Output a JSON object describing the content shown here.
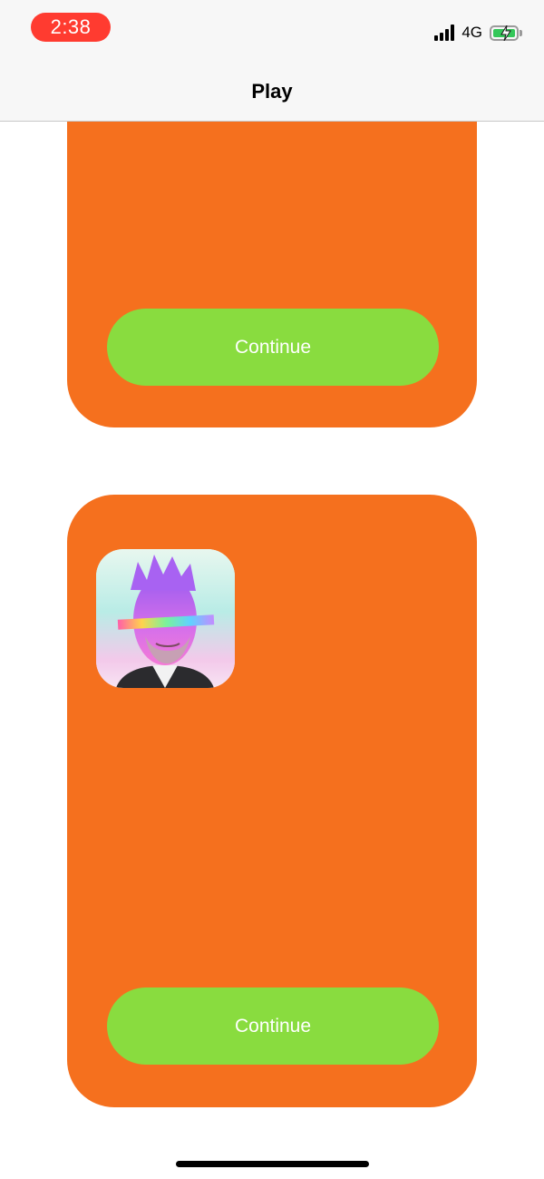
{
  "status_bar": {
    "time": "2:38",
    "network": "4G",
    "icons": [
      "signal-icon",
      "battery-charging-icon"
    ]
  },
  "nav": {
    "title": "Play"
  },
  "cards": [
    {
      "button_label": "Continue"
    },
    {
      "button_label": "Continue",
      "image": "portrait-avatar"
    }
  ],
  "colors": {
    "card": "#f5701e",
    "button": "#89dc3f",
    "time_pill": "#ff3b30",
    "battery": "#34c759"
  }
}
